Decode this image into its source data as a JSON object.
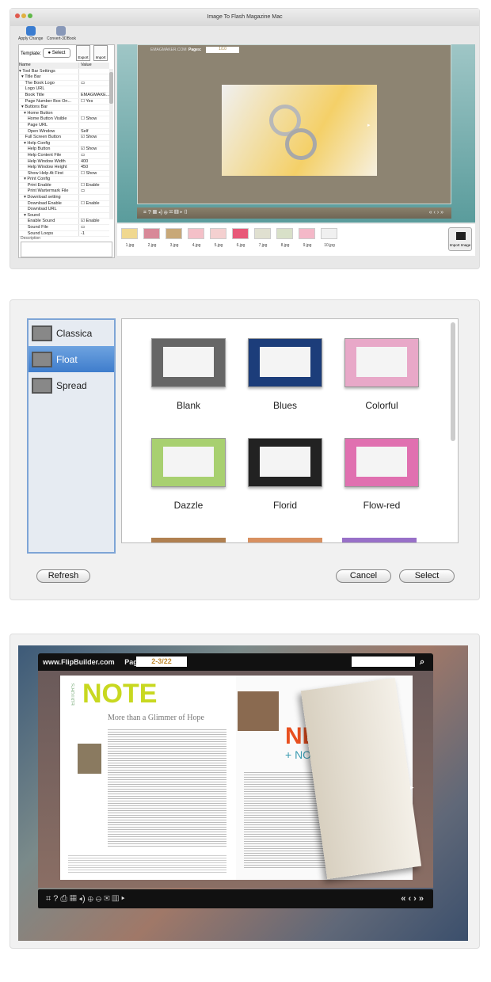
{
  "app1": {
    "title": "Image To Flash Magazine Mac",
    "toolbar": {
      "apply": "Apply Change",
      "convert": "Convert-3DBook"
    },
    "template_label": "Template:",
    "select": "Select",
    "export": "Export",
    "import": "Import",
    "columns": [
      "Name",
      "Value"
    ],
    "tree": [
      [
        "▾ Tool Bar Settings",
        ""
      ],
      [
        "  ▾ Title Bar",
        ""
      ],
      [
        "     The Book Logo",
        "▭"
      ],
      [
        "     Logo URL",
        ""
      ],
      [
        "     Book Title",
        "EMAGMAKE..."
      ],
      [
        "     Page Number Box On...",
        "☐ Yes"
      ],
      [
        "  ▾ Buttons Bar",
        ""
      ],
      [
        "    ▾ Home Button",
        ""
      ],
      [
        "       Home Button Visible",
        "☐ Show"
      ],
      [
        "       Page URL",
        ""
      ],
      [
        "       Open Window",
        "Self"
      ],
      [
        "     Full Screen Button",
        "☑ Show"
      ],
      [
        "    ▾ Help Config",
        ""
      ],
      [
        "       Help Button",
        "☑ Show"
      ],
      [
        "       Help Content File",
        "▭"
      ],
      [
        "       Help Window Width",
        "400"
      ],
      [
        "       Help Window Height",
        "450"
      ],
      [
        "       Show Help At First",
        "☐ Show"
      ],
      [
        "    ▾ Print Config",
        ""
      ],
      [
        "       Print Enable",
        "☐ Enable"
      ],
      [
        "       Print Wartermark File",
        "▭"
      ],
      [
        "    ▾ Download setting",
        ""
      ],
      [
        "       Download Enable",
        "☐ Enable"
      ],
      [
        "       Download URL",
        ""
      ],
      [
        "    ▾ Sound",
        ""
      ],
      [
        "       Enable Sound",
        "☑ Enable"
      ],
      [
        "       Sound File",
        "▭"
      ],
      [
        "       Sound Loops",
        "-1"
      ]
    ],
    "description_label": "Description",
    "book": {
      "site": "EMAGMAKER.COM",
      "pages_label": "Pages:",
      "pages": "1/10"
    },
    "controls": "⌗  ?  ▦  ◂)  ⊕  ✉  ▥  ▸  ▯",
    "nav": "«  ‹  ›  »",
    "thumbs": [
      "1.jpg",
      "2.jpg",
      "3.jpg",
      "4.jpg",
      "5.jpg",
      "6.jpg",
      "7.jpg",
      "8.jpg",
      "9.jpg",
      "10.jpg"
    ],
    "thumb_colors": [
      "#f0d890",
      "#d88898",
      "#c8a878",
      "#f4c0c8",
      "#f4d0d0",
      "#e85878",
      "#e0e0d0",
      "#d8e0c8",
      "#f4b8c8",
      "#f0f0f0"
    ],
    "import_image": "Import Image"
  },
  "app2": {
    "layouts": [
      {
        "label": "Classica",
        "selected": false
      },
      {
        "label": "Float",
        "selected": true
      },
      {
        "label": "Spread",
        "selected": false
      }
    ],
    "templates": [
      {
        "label": "Blank",
        "color": "#666666"
      },
      {
        "label": "Blues",
        "color": "#1c3d7a"
      },
      {
        "label": "Colorful",
        "color": "#e8a8c8"
      },
      {
        "label": "Dazzle",
        "color": "#a8d070"
      },
      {
        "label": "Florid",
        "color": "#222222"
      },
      {
        "label": "Flow-red",
        "color": "#e070b0"
      }
    ],
    "refresh": "Refresh",
    "cancel": "Cancel",
    "select": "Select"
  },
  "app3": {
    "site": "www.FlipBuilder.com",
    "pages_label": "Pages:",
    "pages": "2-3/22",
    "search_placeholder": "",
    "left_page": {
      "kicker": "EDITOR'S",
      "title": "NOTE",
      "headline": "More than a Glimmer of Hope"
    },
    "right_page": {
      "title": "NE",
      "subtitle": "+ NOT"
    },
    "controls": "⌗  ?  ⎙  ▦  ◂)  ⊕  ⊖  ✉  ▥  ▸",
    "nav": "«  ‹  ›  »"
  }
}
